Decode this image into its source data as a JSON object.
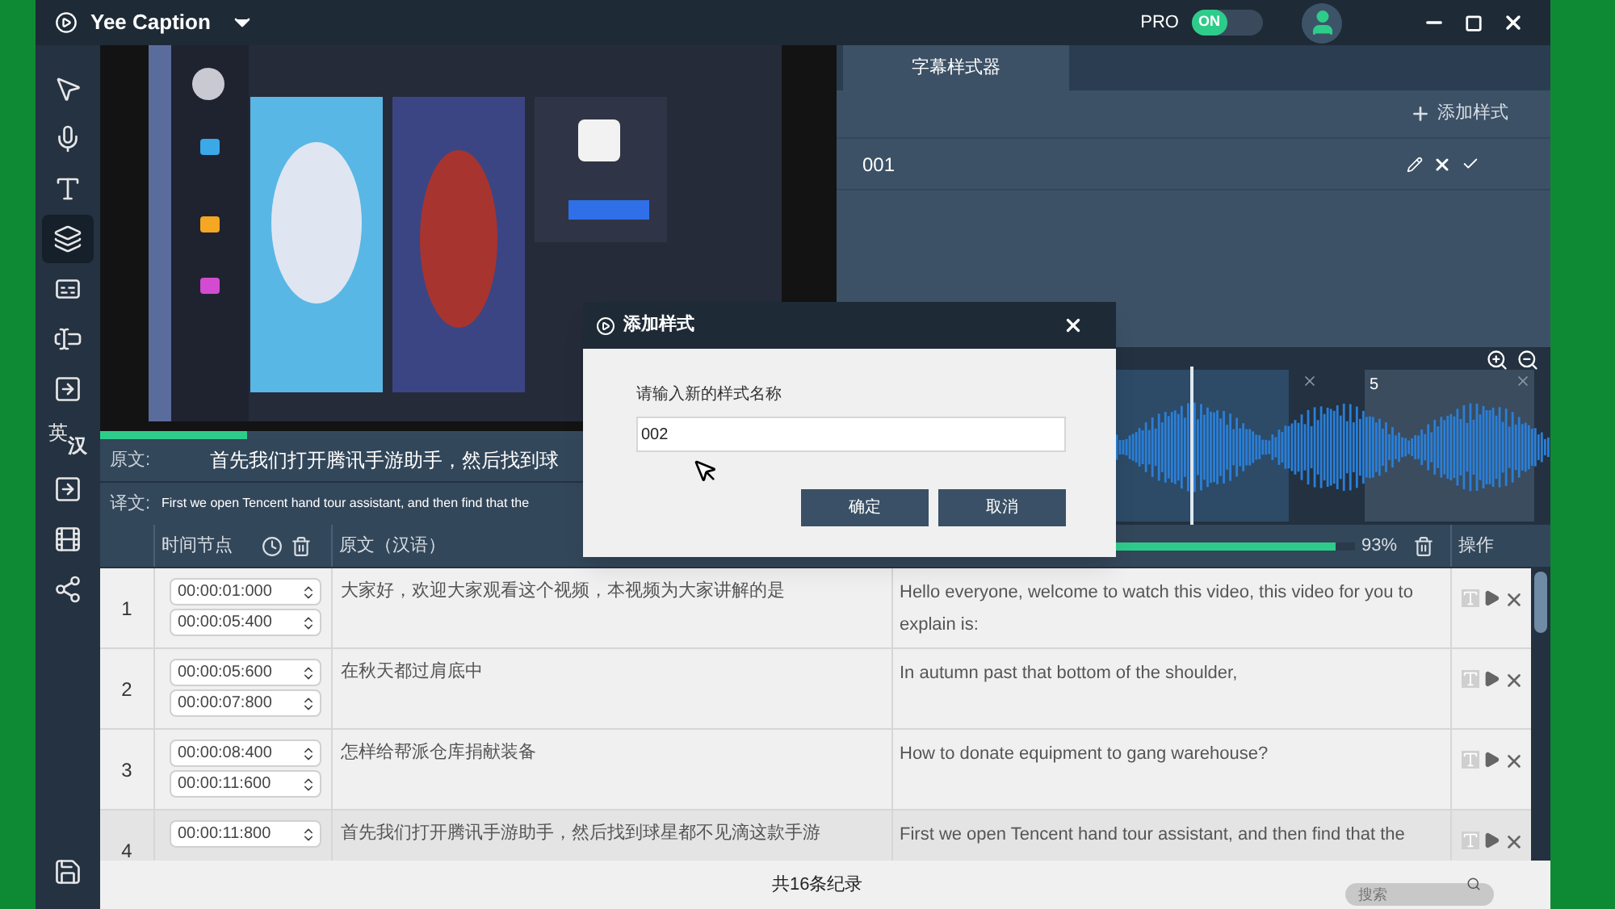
{
  "app": {
    "title": "Yee Caption",
    "pro_label": "PRO",
    "pro_toggle": {
      "label": "ON",
      "on": true
    }
  },
  "tools": [
    {
      "kind": "pointer",
      "selected": false
    },
    {
      "kind": "mic",
      "selected": false
    },
    {
      "kind": "text-size",
      "selected": false
    },
    {
      "kind": "layers",
      "selected": true
    },
    {
      "kind": "text-mic",
      "selected": false
    },
    {
      "kind": "text-box",
      "selected": false
    },
    {
      "kind": "import-text",
      "selected": false
    },
    {
      "kind": "translate",
      "selected": false,
      "glyphs": [
        "英",
        "汉"
      ]
    },
    {
      "kind": "export-text",
      "selected": false
    },
    {
      "kind": "film",
      "selected": false
    },
    {
      "kind": "share",
      "selected": false
    },
    {
      "kind": "save",
      "selected": false
    }
  ],
  "player": {
    "progress": {
      "level": 0.2
    },
    "source_label": "原文:",
    "source_text": "首先我们打开腾讯手游助手，然后找到球",
    "translation_label": "译文:",
    "translation_text": "First we open Tencent hand tour assistant, and then find that the"
  },
  "style_panel": {
    "tab": "字幕样式器",
    "add_button": "添加样式",
    "styles": [
      {
        "name": "001"
      }
    ]
  },
  "waveform": {
    "clip_label": "5"
  },
  "table": {
    "columns": {
      "time": "时间节点",
      "source": "原文（汉语）",
      "ops": "操作"
    },
    "translation_progress": {
      "level": 0.93,
      "reading": "93%"
    },
    "rows": [
      {
        "index": "1",
        "start": "00:00:01:000",
        "end": "00:00:05:400",
        "source": "大家好，欢迎大家观看这个视频，本视频为大家讲解的是",
        "translation": "Hello everyone, welcome to watch this video, this video for you to explain is:",
        "selected": false
      },
      {
        "index": "2",
        "start": "00:00:05:600",
        "end": "00:00:07:800",
        "source": "在秋天都过肩底中",
        "translation": "In autumn past that bottom of the shoulder,",
        "selected": false
      },
      {
        "index": "3",
        "start": "00:00:08:400",
        "end": "00:00:11:600",
        "source": "怎样给帮派仓库捐献装备",
        "translation": "How to donate equipment to gang warehouse?",
        "selected": false
      },
      {
        "index": "4",
        "start": "00:00:11:800",
        "source": "首先我们打开腾讯手游助手，然后找到球星都不见滴这款手游",
        "translation": "First we open Tencent hand tour assistant, and then find that the",
        "selected": true
      }
    ],
    "footer": "共16条纪录",
    "search": {
      "placeholder": "搜索"
    }
  },
  "dialog": {
    "title": "添加样式",
    "prompt": "请输入新的样式名称",
    "value": "002",
    "buttons": [
      "确定",
      "取消"
    ]
  }
}
